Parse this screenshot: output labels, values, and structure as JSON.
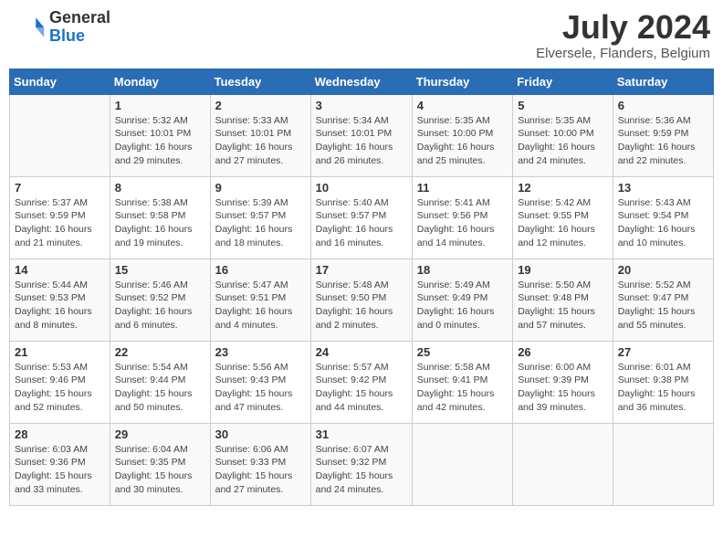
{
  "header": {
    "logo_general": "General",
    "logo_blue": "Blue",
    "month_title": "July 2024",
    "location": "Elversele, Flanders, Belgium"
  },
  "days_of_week": [
    "Sunday",
    "Monday",
    "Tuesday",
    "Wednesday",
    "Thursday",
    "Friday",
    "Saturday"
  ],
  "weeks": [
    [
      {
        "day": "",
        "info": ""
      },
      {
        "day": "1",
        "info": "Sunrise: 5:32 AM\nSunset: 10:01 PM\nDaylight: 16 hours\nand 29 minutes."
      },
      {
        "day": "2",
        "info": "Sunrise: 5:33 AM\nSunset: 10:01 PM\nDaylight: 16 hours\nand 27 minutes."
      },
      {
        "day": "3",
        "info": "Sunrise: 5:34 AM\nSunset: 10:01 PM\nDaylight: 16 hours\nand 26 minutes."
      },
      {
        "day": "4",
        "info": "Sunrise: 5:35 AM\nSunset: 10:00 PM\nDaylight: 16 hours\nand 25 minutes."
      },
      {
        "day": "5",
        "info": "Sunrise: 5:35 AM\nSunset: 10:00 PM\nDaylight: 16 hours\nand 24 minutes."
      },
      {
        "day": "6",
        "info": "Sunrise: 5:36 AM\nSunset: 9:59 PM\nDaylight: 16 hours\nand 22 minutes."
      }
    ],
    [
      {
        "day": "7",
        "info": "Sunrise: 5:37 AM\nSunset: 9:59 PM\nDaylight: 16 hours\nand 21 minutes."
      },
      {
        "day": "8",
        "info": "Sunrise: 5:38 AM\nSunset: 9:58 PM\nDaylight: 16 hours\nand 19 minutes."
      },
      {
        "day": "9",
        "info": "Sunrise: 5:39 AM\nSunset: 9:57 PM\nDaylight: 16 hours\nand 18 minutes."
      },
      {
        "day": "10",
        "info": "Sunrise: 5:40 AM\nSunset: 9:57 PM\nDaylight: 16 hours\nand 16 minutes."
      },
      {
        "day": "11",
        "info": "Sunrise: 5:41 AM\nSunset: 9:56 PM\nDaylight: 16 hours\nand 14 minutes."
      },
      {
        "day": "12",
        "info": "Sunrise: 5:42 AM\nSunset: 9:55 PM\nDaylight: 16 hours\nand 12 minutes."
      },
      {
        "day": "13",
        "info": "Sunrise: 5:43 AM\nSunset: 9:54 PM\nDaylight: 16 hours\nand 10 minutes."
      }
    ],
    [
      {
        "day": "14",
        "info": "Sunrise: 5:44 AM\nSunset: 9:53 PM\nDaylight: 16 hours\nand 8 minutes."
      },
      {
        "day": "15",
        "info": "Sunrise: 5:46 AM\nSunset: 9:52 PM\nDaylight: 16 hours\nand 6 minutes."
      },
      {
        "day": "16",
        "info": "Sunrise: 5:47 AM\nSunset: 9:51 PM\nDaylight: 16 hours\nand 4 minutes."
      },
      {
        "day": "17",
        "info": "Sunrise: 5:48 AM\nSunset: 9:50 PM\nDaylight: 16 hours\nand 2 minutes."
      },
      {
        "day": "18",
        "info": "Sunrise: 5:49 AM\nSunset: 9:49 PM\nDaylight: 16 hours\nand 0 minutes."
      },
      {
        "day": "19",
        "info": "Sunrise: 5:50 AM\nSunset: 9:48 PM\nDaylight: 15 hours\nand 57 minutes."
      },
      {
        "day": "20",
        "info": "Sunrise: 5:52 AM\nSunset: 9:47 PM\nDaylight: 15 hours\nand 55 minutes."
      }
    ],
    [
      {
        "day": "21",
        "info": "Sunrise: 5:53 AM\nSunset: 9:46 PM\nDaylight: 15 hours\nand 52 minutes."
      },
      {
        "day": "22",
        "info": "Sunrise: 5:54 AM\nSunset: 9:44 PM\nDaylight: 15 hours\nand 50 minutes."
      },
      {
        "day": "23",
        "info": "Sunrise: 5:56 AM\nSunset: 9:43 PM\nDaylight: 15 hours\nand 47 minutes."
      },
      {
        "day": "24",
        "info": "Sunrise: 5:57 AM\nSunset: 9:42 PM\nDaylight: 15 hours\nand 44 minutes."
      },
      {
        "day": "25",
        "info": "Sunrise: 5:58 AM\nSunset: 9:41 PM\nDaylight: 15 hours\nand 42 minutes."
      },
      {
        "day": "26",
        "info": "Sunrise: 6:00 AM\nSunset: 9:39 PM\nDaylight: 15 hours\nand 39 minutes."
      },
      {
        "day": "27",
        "info": "Sunrise: 6:01 AM\nSunset: 9:38 PM\nDaylight: 15 hours\nand 36 minutes."
      }
    ],
    [
      {
        "day": "28",
        "info": "Sunrise: 6:03 AM\nSunset: 9:36 PM\nDaylight: 15 hours\nand 33 minutes."
      },
      {
        "day": "29",
        "info": "Sunrise: 6:04 AM\nSunset: 9:35 PM\nDaylight: 15 hours\nand 30 minutes."
      },
      {
        "day": "30",
        "info": "Sunrise: 6:06 AM\nSunset: 9:33 PM\nDaylight: 15 hours\nand 27 minutes."
      },
      {
        "day": "31",
        "info": "Sunrise: 6:07 AM\nSunset: 9:32 PM\nDaylight: 15 hours\nand 24 minutes."
      },
      {
        "day": "",
        "info": ""
      },
      {
        "day": "",
        "info": ""
      },
      {
        "day": "",
        "info": ""
      }
    ]
  ]
}
